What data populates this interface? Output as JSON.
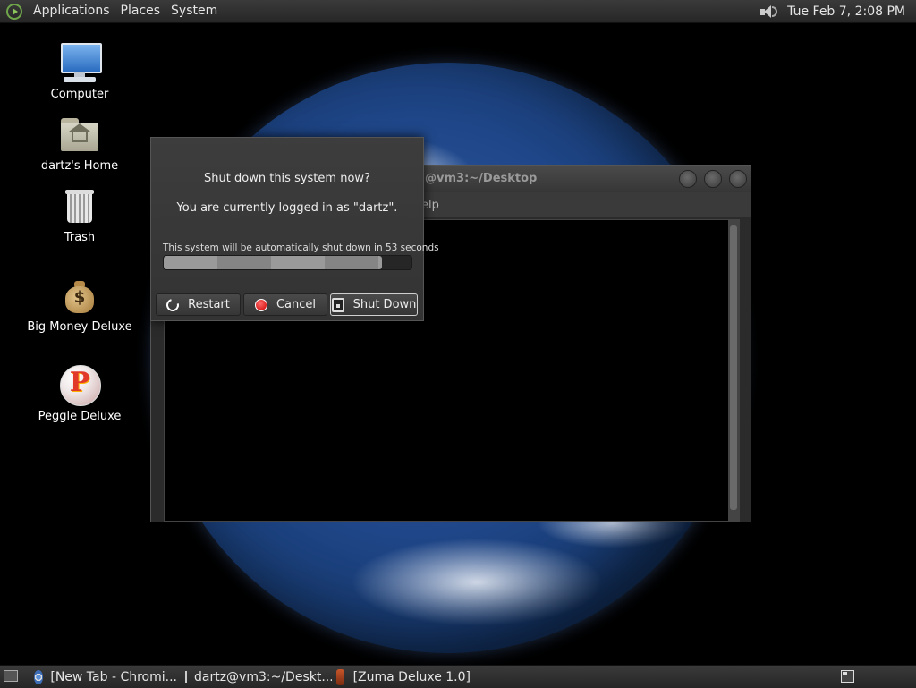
{
  "top_panel": {
    "menus": [
      "Applications",
      "Places",
      "System"
    ],
    "clock": "Tue Feb  7,  2:08 PM"
  },
  "desktop": {
    "icons": [
      {
        "label": "Computer",
        "icon": "computer-icon"
      },
      {
        "label": "dartz's Home",
        "icon": "home-folder-icon"
      },
      {
        "label": "Trash",
        "icon": "trash-icon"
      },
      {
        "label": "Big Money Deluxe",
        "icon": "money-bag-icon"
      },
      {
        "label": "Peggle Deluxe",
        "icon": "peggle-icon"
      }
    ]
  },
  "terminal": {
    "title": "@vm3:~/Desktop",
    "menu_fragment": "elp"
  },
  "dialog": {
    "question": "Shut down this system now?",
    "logged_in": "You are currently logged in as \"dartz\".",
    "countdown": "This system will be automatically shut down in 53 seconds",
    "progress_fraction": 0.88,
    "buttons": {
      "restart": "Restart",
      "cancel": "Cancel",
      "shutdown": "Shut Down"
    }
  },
  "bottom_panel": {
    "tasks": [
      {
        "label": "[New Tab - Chromi...",
        "icon": "chromium-icon"
      },
      {
        "label": "dartz@vm3:~/Deskt...",
        "icon": "terminal-icon"
      },
      {
        "label": "[Zuma Deluxe 1.0]",
        "icon": "zuma-icon"
      }
    ]
  }
}
